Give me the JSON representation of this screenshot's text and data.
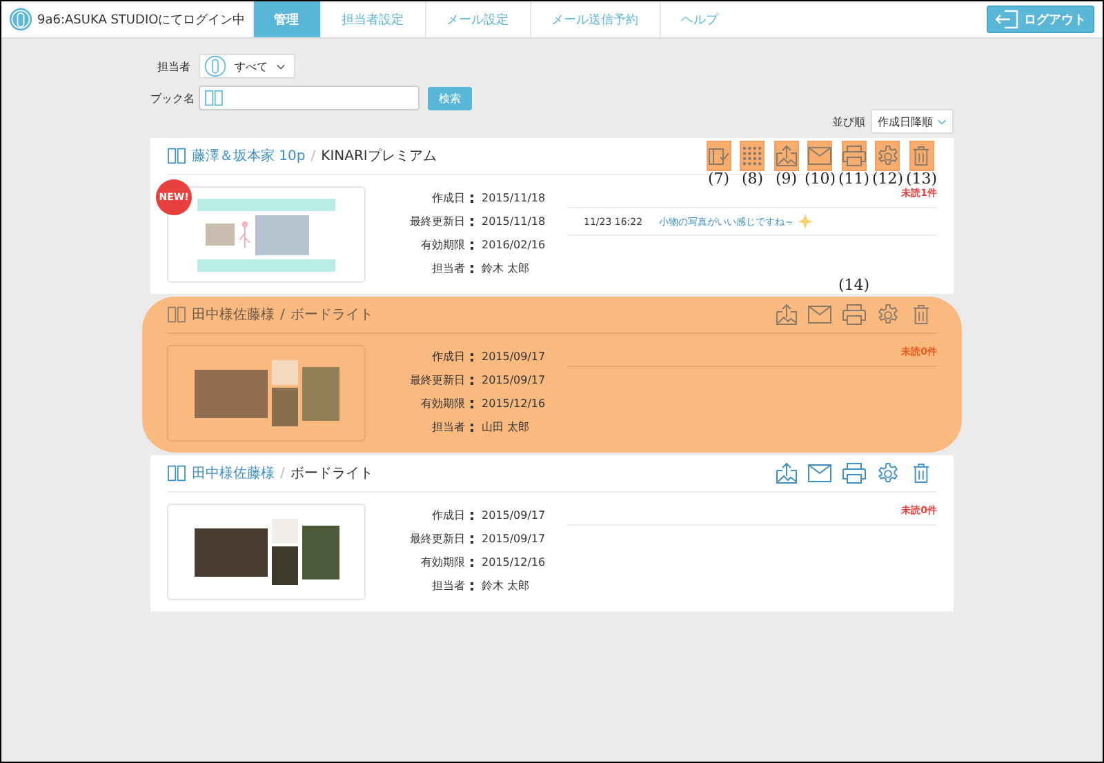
{
  "header": {
    "login_label": "9a6:ASUKA STUDIOにてログイン中",
    "logout": "ログアウト"
  },
  "tabs": [
    {
      "label": "管理",
      "selected": true
    },
    {
      "label": "担当者設定",
      "selected": false
    },
    {
      "label": "メール設定",
      "selected": false
    },
    {
      "label": "メール送信予約",
      "selected": false
    },
    {
      "label": "ヘルプ",
      "selected": false
    }
  ],
  "filters": {
    "assignee_label": "担当者",
    "assignee_value": "すべて",
    "book_label": "ブック名",
    "search_button": "検索",
    "sort_label": "並び順",
    "sort_value": "作成日降順"
  },
  "books": [
    {
      "title": "藤澤＆坂本家 10p",
      "separator": "/",
      "subtitle": "KINARIプレミアム",
      "badge": "NEW!",
      "highlighted": false,
      "kind": "pastel",
      "unread": "未読1件",
      "actions": [
        {
          "kind": "book-check",
          "highlighted": true,
          "callout": "(7)"
        },
        {
          "kind": "grid",
          "highlighted": true,
          "callout": "(8)"
        },
        {
          "kind": "upload",
          "highlighted": true,
          "callout": "(9)"
        },
        {
          "kind": "mail",
          "highlighted": true,
          "callout": "(10)"
        },
        {
          "kind": "print",
          "highlighted": true,
          "callout": "(11)"
        },
        {
          "kind": "gear",
          "highlighted": true,
          "callout": "(12)"
        },
        {
          "kind": "trash",
          "highlighted": true,
          "callout": "(13)"
        }
      ],
      "info": [
        {
          "label": "作成日",
          "value": "2015/11/18"
        },
        {
          "label": "最終更新日",
          "value": "2015/11/18"
        },
        {
          "label": "有効期限",
          "value": "2016/02/16"
        },
        {
          "label": "担当者",
          "value": "鈴木 太郎"
        }
      ],
      "comments": [
        {
          "time": "11/23 16:22",
          "text": "小物の写真がいい感じですね～"
        }
      ]
    },
    {
      "title": "田中様佐藤様",
      "separator": "/",
      "subtitle": "ボードライト",
      "highlighted": true,
      "kind": "dark",
      "unread": "未読0件",
      "actions": [
        {
          "kind": "upload",
          "highlighted": false
        },
        {
          "kind": "mail",
          "highlighted": false
        },
        {
          "kind": "print",
          "highlighted": false,
          "callout": "(14)"
        },
        {
          "kind": "gear",
          "highlighted": false
        },
        {
          "kind": "trash",
          "highlighted": false
        }
      ],
      "info": [
        {
          "label": "作成日",
          "value": "2015/09/17"
        },
        {
          "label": "最終更新日",
          "value": "2015/09/17"
        },
        {
          "label": "有効期限",
          "value": "2015/12/16"
        },
        {
          "label": "担当者",
          "value": "山田 太郎"
        }
      ]
    },
    {
      "title": "田中様佐藤様",
      "separator": "/",
      "subtitle": "ボードライト",
      "highlighted": false,
      "kind": "dark",
      "unread": "未読0件",
      "actions": [
        {
          "kind": "upload",
          "highlighted": false
        },
        {
          "kind": "mail",
          "highlighted": false
        },
        {
          "kind": "print",
          "highlighted": false
        },
        {
          "kind": "gear",
          "highlighted": false
        },
        {
          "kind": "trash",
          "highlighted": false
        }
      ],
      "info": [
        {
          "label": "作成日",
          "value": "2015/09/17"
        },
        {
          "label": "最終更新日",
          "value": "2015/09/17"
        },
        {
          "label": "有効期限",
          "value": "2015/12/16"
        },
        {
          "label": "担当者",
          "value": "鈴木 太郎"
        }
      ]
    }
  ]
}
